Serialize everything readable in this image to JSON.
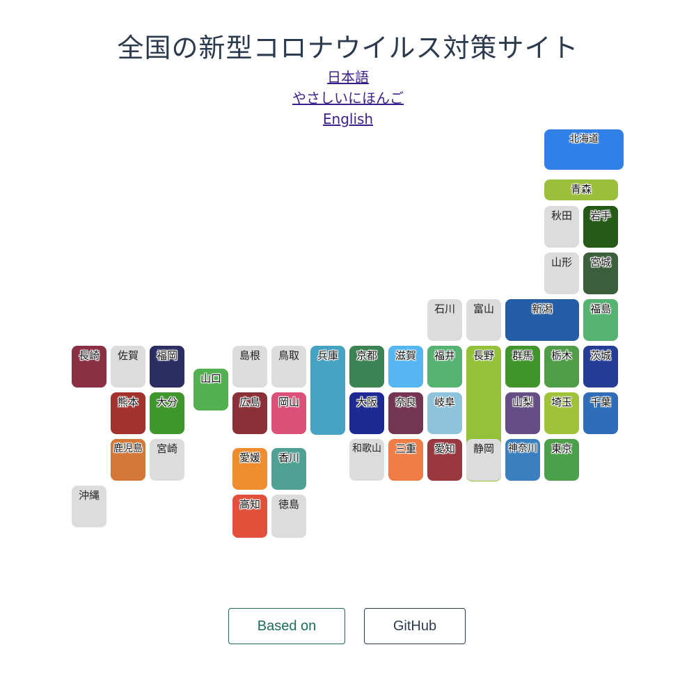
{
  "title": "全国の新型コロナウイルス対策サイト",
  "languages": [
    "日本語",
    "やさしいにほんご",
    "English"
  ],
  "buttons": {
    "based_on": "Based on",
    "github": "GitHub"
  },
  "prefectures": [
    {
      "id": "hokkaido",
      "name": "北海道",
      "color": "#3080e8"
    },
    {
      "id": "aomori",
      "name": "青森",
      "color": "#9bbf3a"
    },
    {
      "id": "akita",
      "name": "秋田",
      "color": "#dcdcdc"
    },
    {
      "id": "iwate",
      "name": "岩手",
      "color": "#245a16"
    },
    {
      "id": "yamagata",
      "name": "山形",
      "color": "#dcdcdc"
    },
    {
      "id": "miyagi",
      "name": "宮城",
      "color": "#3b5f3a"
    },
    {
      "id": "ishikawa",
      "name": "石川",
      "color": "#dcdcdc"
    },
    {
      "id": "toyama",
      "name": "富山",
      "color": "#dcdcdc"
    },
    {
      "id": "niigata",
      "name": "新潟",
      "color": "#255ea6"
    },
    {
      "id": "fukushima",
      "name": "福島",
      "color": "#55b270"
    },
    {
      "id": "nagasaki",
      "name": "長崎",
      "color": "#8b3044"
    },
    {
      "id": "saga",
      "name": "佐賀",
      "color": "#dcdcdc"
    },
    {
      "id": "fukuoka",
      "name": "福岡",
      "color": "#2c2e63"
    },
    {
      "id": "yamaguchi",
      "name": "山口",
      "color": "#51b04f"
    },
    {
      "id": "shimane",
      "name": "島根",
      "color": "#dcdcdc"
    },
    {
      "id": "tottori",
      "name": "鳥取",
      "color": "#dcdcdc"
    },
    {
      "id": "hyogo",
      "name": "兵庫",
      "color": "#45a2c3"
    },
    {
      "id": "kyoto",
      "name": "京都",
      "color": "#3b8353"
    },
    {
      "id": "shiga",
      "name": "滋賀",
      "color": "#55b6f2"
    },
    {
      "id": "fukui",
      "name": "福井",
      "color": "#55b270"
    },
    {
      "id": "nagano",
      "name": "長野",
      "color": "#94c13a"
    },
    {
      "id": "gunma",
      "name": "群馬",
      "color": "#3f952a"
    },
    {
      "id": "tochigi",
      "name": "栃木",
      "color": "#4f9d47"
    },
    {
      "id": "ibaraki",
      "name": "茨城",
      "color": "#263d96"
    },
    {
      "id": "kumamoto",
      "name": "熊本",
      "color": "#a3312e"
    },
    {
      "id": "oita",
      "name": "大分",
      "color": "#3f962a"
    },
    {
      "id": "hiroshima",
      "name": "広島",
      "color": "#8c3038"
    },
    {
      "id": "okayama",
      "name": "岡山",
      "color": "#db5078"
    },
    {
      "id": "osaka",
      "name": "大阪",
      "color": "#1e2a94"
    },
    {
      "id": "nara",
      "name": "奈良",
      "color": "#743552"
    },
    {
      "id": "gifu",
      "name": "岐阜",
      "color": "#8ec3dc"
    },
    {
      "id": "yamanashi",
      "name": "山梨",
      "color": "#654e86"
    },
    {
      "id": "saitama",
      "name": "埼玉",
      "color": "#a0c23a"
    },
    {
      "id": "chiba",
      "name": "千葉",
      "color": "#2f6db8"
    },
    {
      "id": "kagoshima",
      "name": "鹿児島",
      "color": "#d4783a"
    },
    {
      "id": "miyazaki",
      "name": "宮崎",
      "color": "#dcdcdc"
    },
    {
      "id": "ehime",
      "name": "愛媛",
      "color": "#ee8c2e"
    },
    {
      "id": "kagawa",
      "name": "香川",
      "color": "#4fa193"
    },
    {
      "id": "wakayama",
      "name": "和歌山",
      "color": "#dcdcdc"
    },
    {
      "id": "mie",
      "name": "三重",
      "color": "#ef7d45"
    },
    {
      "id": "aichi",
      "name": "愛知",
      "color": "#9a3840"
    },
    {
      "id": "shizuoka",
      "name": "静岡",
      "color": "#dcdcdc"
    },
    {
      "id": "kanagawa",
      "name": "神奈川",
      "color": "#3a80c0"
    },
    {
      "id": "tokyo",
      "name": "東京",
      "color": "#4da04a"
    },
    {
      "id": "okinawa",
      "name": "沖縄",
      "color": "#dcdcdc"
    },
    {
      "id": "kochi",
      "name": "高知",
      "color": "#e2503c"
    },
    {
      "id": "tokushima",
      "name": "徳島",
      "color": "#dcdcdc"
    }
  ]
}
